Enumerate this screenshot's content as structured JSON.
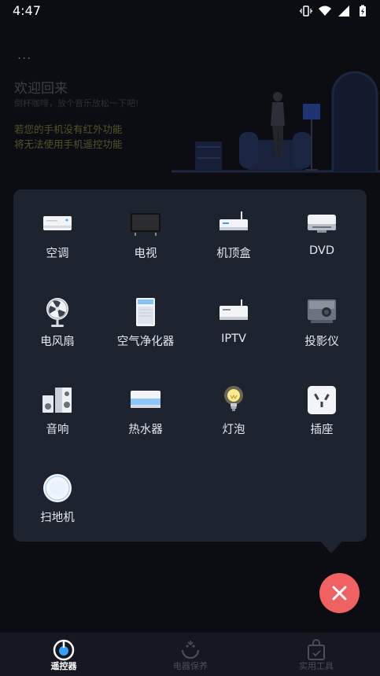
{
  "status_bar": {
    "time": "4:47"
  },
  "background": {
    "menu_dots": "...",
    "welcome_title": "欢迎回来",
    "welcome_subtitle": "倒杯咖啡，放个音乐放松一下吧!",
    "warning_line1": "若您的手机没有红外功能",
    "warning_line2": "将无法使用手机遥控功能"
  },
  "device_menu": {
    "items": [
      {
        "label": "空调",
        "icon": "air-conditioner-icon"
      },
      {
        "label": "电视",
        "icon": "tv-icon"
      },
      {
        "label": "机顶盒",
        "icon": "set-top-box-icon"
      },
      {
        "label": "DVD",
        "icon": "dvd-player-icon"
      },
      {
        "label": "电风扇",
        "icon": "fan-icon"
      },
      {
        "label": "空气净化器",
        "icon": "air-purifier-icon"
      },
      {
        "label": "IPTV",
        "icon": "iptv-box-icon"
      },
      {
        "label": "投影仪",
        "icon": "projector-icon"
      },
      {
        "label": "音响",
        "icon": "speaker-icon"
      },
      {
        "label": "热水器",
        "icon": "water-heater-icon"
      },
      {
        "label": "灯泡",
        "icon": "light-bulb-icon"
      },
      {
        "label": "插座",
        "icon": "power-socket-icon"
      },
      {
        "label": "扫地机",
        "icon": "robot-vacuum-icon"
      }
    ]
  },
  "fab": {
    "icon": "close-icon",
    "color": "#f06161"
  },
  "bottom_nav": [
    {
      "label": "遥控器",
      "icon": "remote-icon",
      "active": true
    },
    {
      "label": "电器保养",
      "icon": "maintenance-icon",
      "active": false
    },
    {
      "label": "实用工具",
      "icon": "tools-bag-icon",
      "active": false
    }
  ]
}
